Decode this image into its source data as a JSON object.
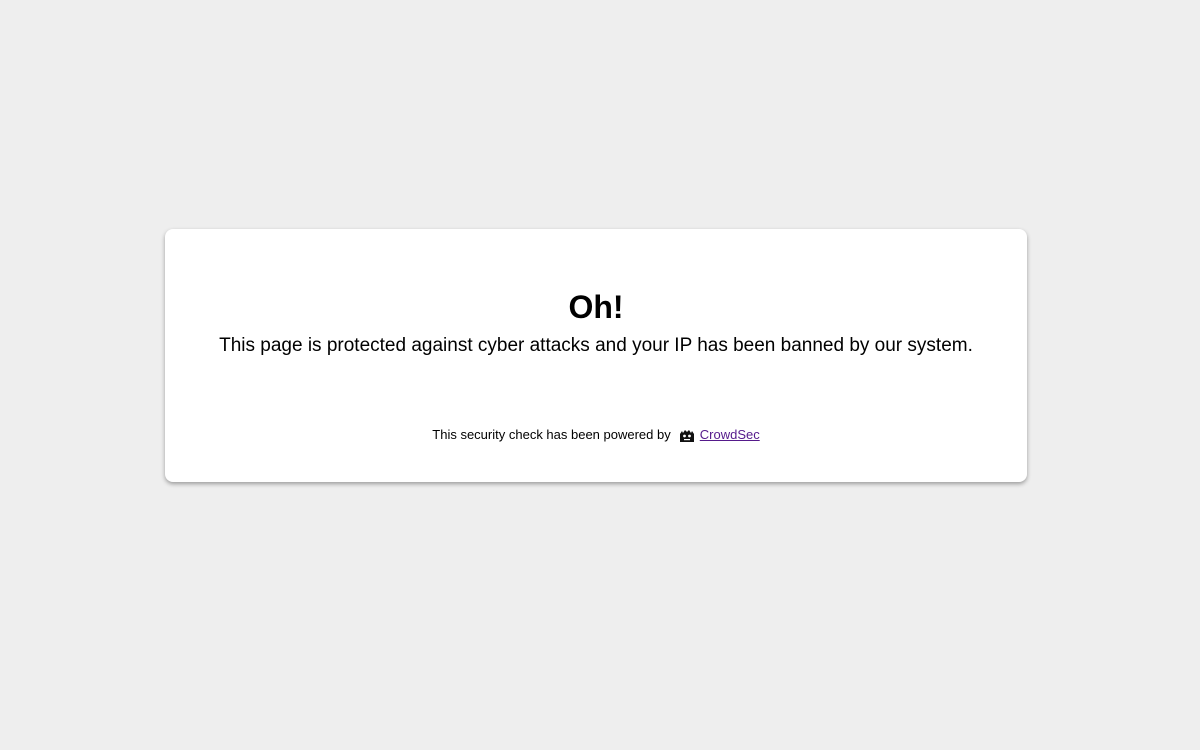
{
  "page": {
    "background_color": "#eeeeee"
  },
  "card": {
    "title": "Oh!",
    "message": "This page is protected against cyber attacks and your IP has been banned by our system.",
    "footer": {
      "powered_by_text": "This security check has been powered by",
      "logo_icon": "crowdsec-logo-icon",
      "link_text": "CrowdSec",
      "link_color": "#551a8b"
    }
  }
}
